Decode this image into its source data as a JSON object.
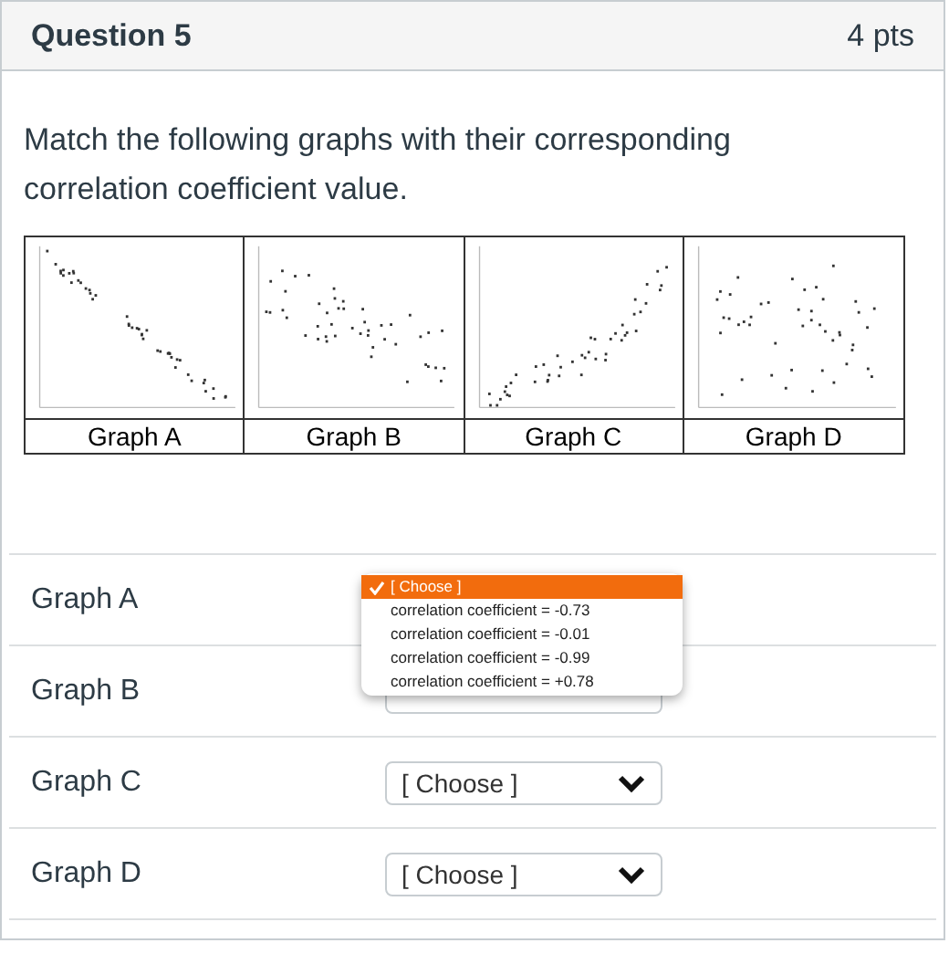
{
  "question": {
    "title": "Question 5",
    "points": "4 pts"
  },
  "prompt": "Match the following graphs with their corresponding correlation coefficient value.",
  "graphs": [
    {
      "label": "Graph A"
    },
    {
      "label": "Graph B"
    },
    {
      "label": "Graph C"
    },
    {
      "label": "Graph D"
    }
  ],
  "matches": [
    {
      "label": "Graph A",
      "open": true
    },
    {
      "label": "Graph B",
      "open": false
    },
    {
      "label": "Graph C",
      "open": false,
      "value": "[ Choose ]"
    },
    {
      "label": "Graph D",
      "open": false,
      "value": "[ Choose ]"
    }
  ],
  "dropdown": {
    "options": [
      {
        "label": "[ Choose ]",
        "selected": true
      },
      {
        "label": "correlation coefficient = -0.73",
        "selected": false
      },
      {
        "label": "correlation coefficient = -0.01",
        "selected": false
      },
      {
        "label": "correlation coefficient = -0.99",
        "selected": false
      },
      {
        "label": "correlation coefficient = +0.78",
        "selected": false
      }
    ]
  }
}
